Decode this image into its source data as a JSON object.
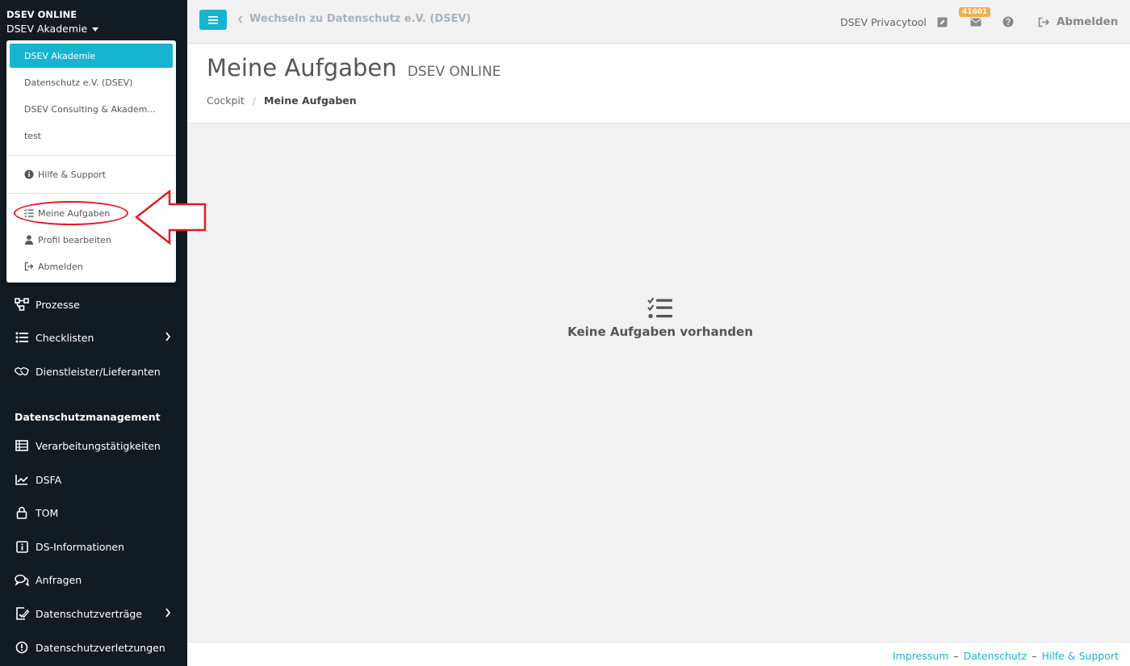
{
  "sidebar": {
    "org_title": "DSEV ONLINE",
    "org_switch_label": "DSEV Akademie",
    "section_title": "Datenschutzmanagement",
    "items": [
      {
        "label": "Prozesse",
        "icon": "flow-icon"
      },
      {
        "label": "Checklisten",
        "icon": "list-icon"
      },
      {
        "label": "Dienstleister/Lieferanten",
        "icon": "handshake-icon"
      },
      {
        "label": "Verarbeitungstätigkeiten",
        "icon": "table-icon"
      },
      {
        "label": "DSFA",
        "icon": "chart-line-icon"
      },
      {
        "label": "TOM",
        "icon": "lock-icon"
      },
      {
        "label": "DS-Informationen",
        "icon": "info-icon"
      },
      {
        "label": "Anfragen",
        "icon": "chat-icon"
      },
      {
        "label": "Datenschutzverträge",
        "icon": "contract-icon"
      },
      {
        "label": "Datenschutzverletzungen",
        "icon": "alert-icon"
      }
    ]
  },
  "dropdown": {
    "orgs": [
      "DSEV Akademie",
      "Datenschutz e.V. (DSEV)",
      "DSEV Consulting & Akadem...",
      "test"
    ],
    "help": "Hilfe & Support",
    "my_tasks": "Meine Aufgaben",
    "edit_profile": "Profil bearbeiten",
    "logout": "Abmelden"
  },
  "topbar": {
    "back_link": "Wechseln zu Datenschutz e.V. (DSEV)",
    "app_name": "DSEV Privacytool",
    "mail_badge": "41601",
    "logout": "Abmelden"
  },
  "page": {
    "title": "Meine Aufgaben",
    "subtitle": "DSEV ONLINE",
    "breadcrumb": [
      "Cockpit",
      "Meine Aufgaben"
    ],
    "empty_message": "Keine Aufgaben vorhanden"
  },
  "footer": {
    "links": [
      "Impressum",
      "Datenschutz",
      "Hilfe & Support"
    ]
  },
  "colors": {
    "accent": "#17b4cf",
    "sidebar_bg": "#131b22",
    "badge": "#f0ad4e",
    "annotation": "#e01b24"
  }
}
